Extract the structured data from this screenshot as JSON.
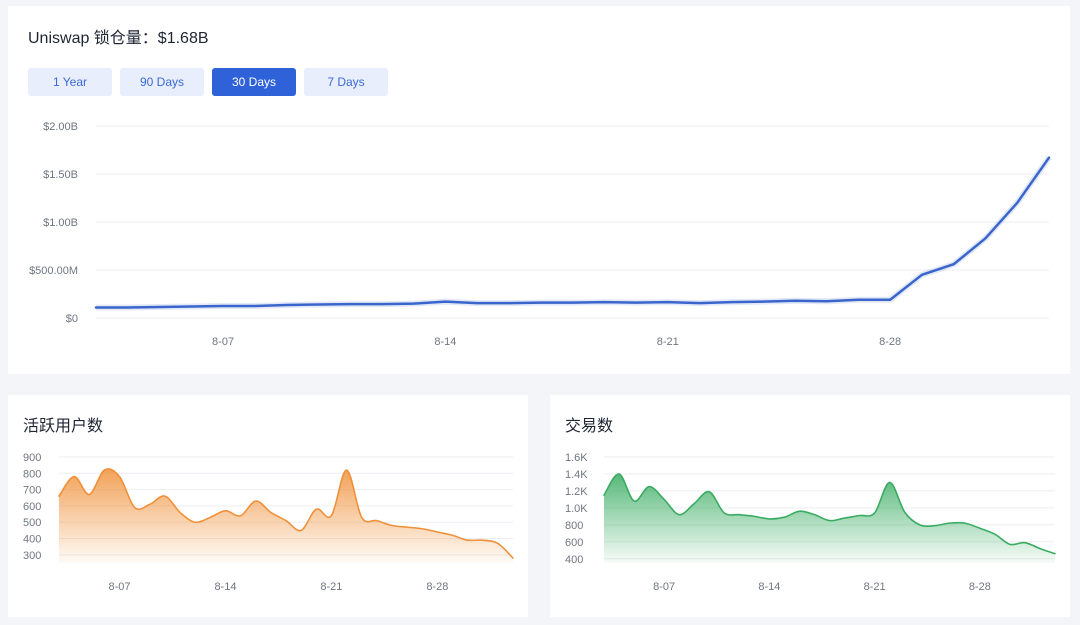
{
  "tvl": {
    "title": "Uniswap 锁仓量：$1.68B",
    "ranges": [
      "1 Year",
      "90 Days",
      "30 Days",
      "7 Days"
    ],
    "active_range": "30 Days",
    "line_color": "#3a66cc"
  },
  "users": {
    "title": "活跃用户数",
    "color": "#f0913a"
  },
  "tx": {
    "title": "交易数",
    "color": "#3aac62"
  },
  "chart_data": [
    {
      "id": "tvl",
      "type": "line",
      "title": "Uniswap 锁仓量：$1.68B",
      "x": [
        "8-03",
        "8-04",
        "8-05",
        "8-06",
        "8-07",
        "8-08",
        "8-09",
        "8-10",
        "8-11",
        "8-12",
        "8-13",
        "8-14",
        "8-15",
        "8-16",
        "8-17",
        "8-18",
        "8-19",
        "8-20",
        "8-21",
        "8-22",
        "8-23",
        "8-24",
        "8-25",
        "8-26",
        "8-27",
        "8-28",
        "8-29",
        "8-30",
        "8-31",
        "9-01",
        "9-02"
      ],
      "series": [
        {
          "values": [
            0.11,
            0.11,
            0.115,
            0.12,
            0.125,
            0.125,
            0.135,
            0.14,
            0.145,
            0.145,
            0.15,
            0.17,
            0.155,
            0.155,
            0.16,
            0.16,
            0.165,
            0.16,
            0.165,
            0.155,
            0.165,
            0.17,
            0.18,
            0.175,
            0.19,
            0.19,
            0.45,
            0.56,
            0.83,
            1.2,
            1.67
          ]
        }
      ],
      "x_tick_labels": [
        "8-07",
        "8-14",
        "8-21",
        "8-28"
      ],
      "y_tick_labels": [
        "$0",
        "$500.00M",
        "$1.00B",
        "$1.50B",
        "$2.00B"
      ],
      "ylim": [
        0,
        2.0
      ],
      "y_unit": "B",
      "grid": true,
      "legend": "none"
    },
    {
      "id": "users",
      "type": "area",
      "title": "活跃用户数",
      "x": [
        "8-03",
        "8-04",
        "8-05",
        "8-06",
        "8-07",
        "8-08",
        "8-09",
        "8-10",
        "8-11",
        "8-12",
        "8-13",
        "8-14",
        "8-15",
        "8-16",
        "8-17",
        "8-18",
        "8-19",
        "8-20",
        "8-21",
        "8-22",
        "8-23",
        "8-24",
        "8-25",
        "8-26",
        "8-27",
        "8-28",
        "8-29",
        "8-30",
        "8-31",
        "9-01",
        "9-02"
      ],
      "series": [
        {
          "values": [
            660,
            780,
            670,
            820,
            780,
            590,
            610,
            660,
            560,
            500,
            530,
            570,
            540,
            630,
            560,
            510,
            450,
            580,
            540,
            820,
            530,
            510,
            480,
            470,
            460,
            440,
            420,
            390,
            390,
            370,
            280
          ]
        }
      ],
      "x_tick_labels": [
        "8-07",
        "8-14",
        "8-21",
        "8-28"
      ],
      "y_tick_labels": [
        "300",
        "400",
        "500",
        "600",
        "700",
        "800",
        "900"
      ],
      "ylim": [
        250,
        900
      ],
      "grid": true,
      "legend": "none"
    },
    {
      "id": "tx",
      "type": "area",
      "title": "交易数",
      "x": [
        "8-03",
        "8-04",
        "8-05",
        "8-06",
        "8-07",
        "8-08",
        "8-09",
        "8-10",
        "8-11",
        "8-12",
        "8-13",
        "8-14",
        "8-15",
        "8-16",
        "8-17",
        "8-18",
        "8-19",
        "8-20",
        "8-21",
        "8-22",
        "8-23",
        "8-24",
        "8-25",
        "8-26",
        "8-27",
        "8-28",
        "8-29",
        "8-30",
        "8-31",
        "9-01",
        "9-02"
      ],
      "series": [
        {
          "values": [
            1150,
            1400,
            1080,
            1250,
            1100,
            920,
            1050,
            1190,
            940,
            920,
            900,
            870,
            890,
            960,
            920,
            850,
            880,
            910,
            940,
            1300,
            950,
            800,
            790,
            820,
            820,
            760,
            690,
            570,
            590,
            520,
            460
          ]
        }
      ],
      "x_tick_labels": [
        "8-07",
        "8-14",
        "8-21",
        "8-28"
      ],
      "y_tick_labels": [
        "400",
        "600",
        "800",
        "1.0K",
        "1.2K",
        "1.4K",
        "1.6K"
      ],
      "ylim": [
        350,
        1600
      ],
      "grid": true,
      "legend": "none"
    }
  ]
}
